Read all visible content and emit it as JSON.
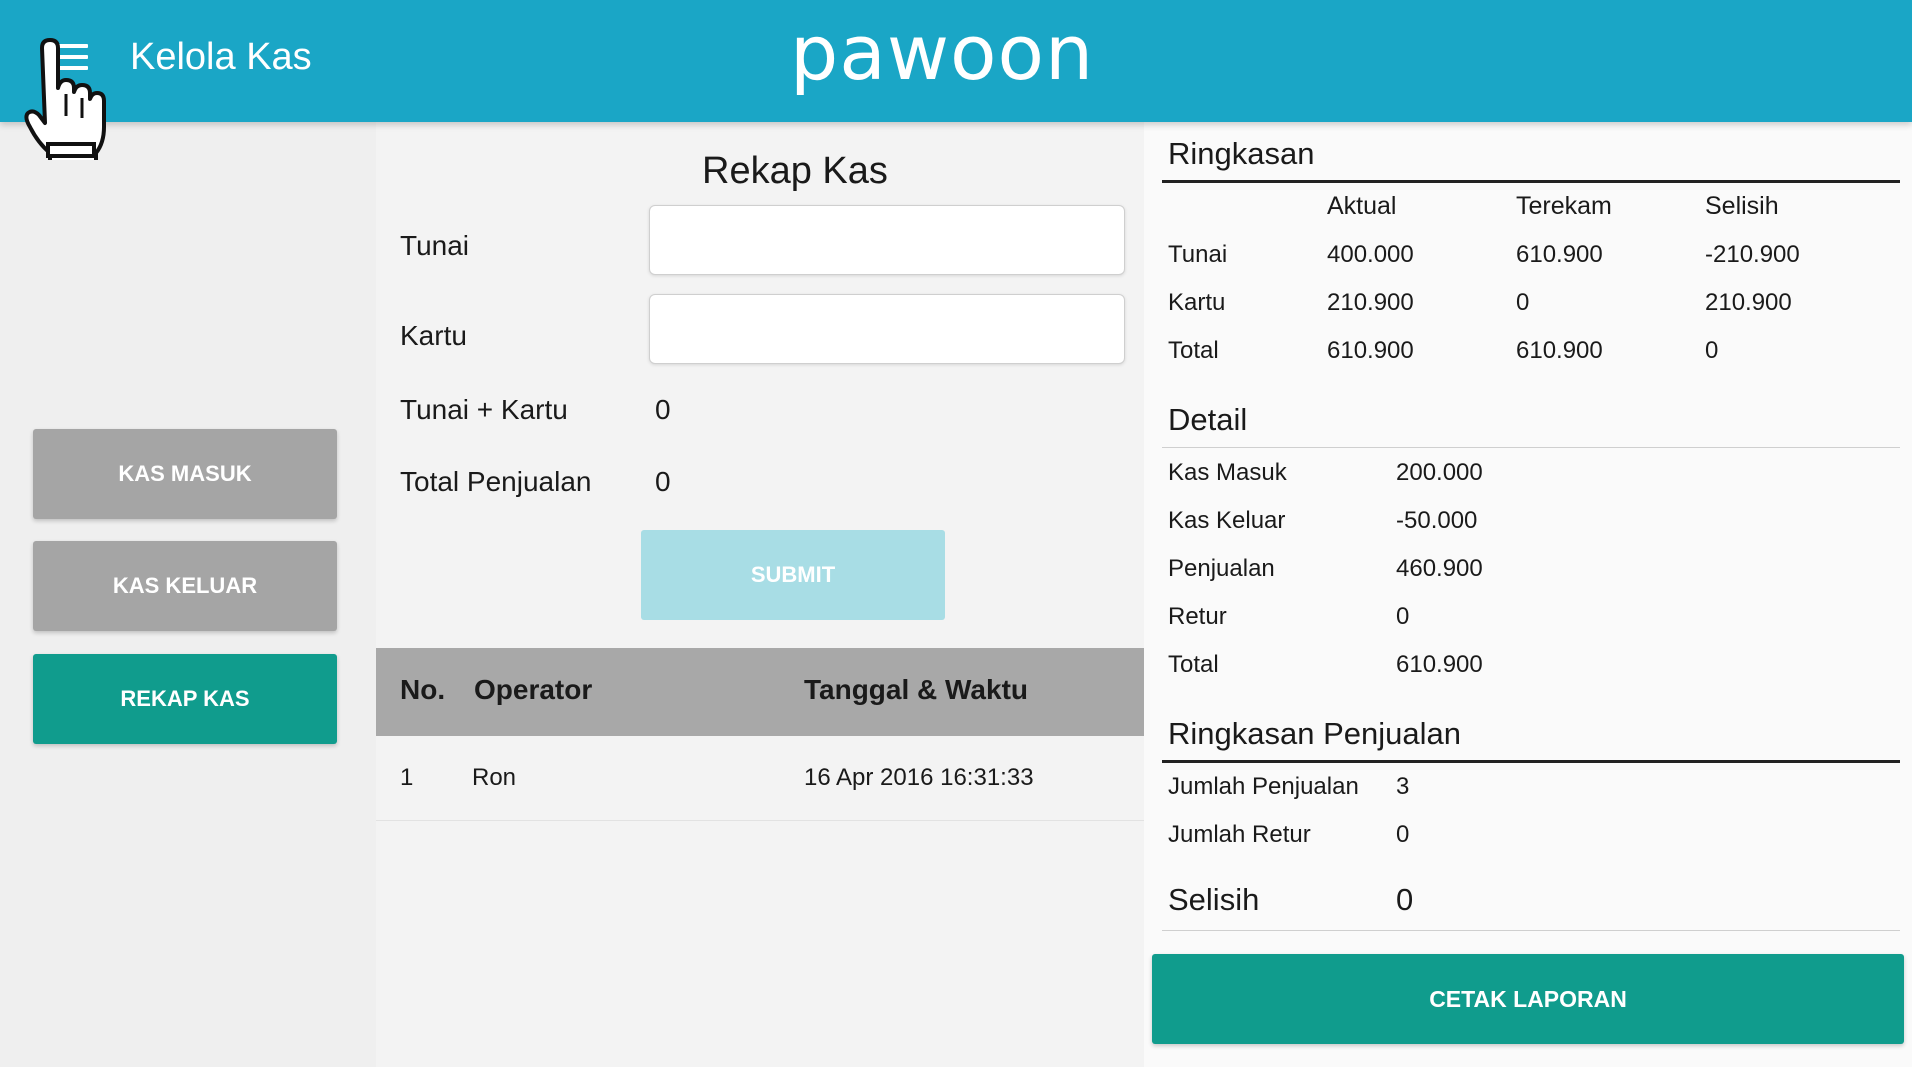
{
  "header": {
    "title": "Kelola Kas",
    "logo": "pawoon",
    "menu_icon": "hamburger-menu-icon",
    "cursor_icon": "hand-pointer-icon",
    "color": "#1aa6c6"
  },
  "sidebar": {
    "kas_masuk": "KAS MASUK",
    "kas_keluar": "KAS KELUAR",
    "rekap_kas": "REKAP KAS"
  },
  "form": {
    "title": "Rekap Kas",
    "tunai_label": "Tunai",
    "tunai_value": "",
    "kartu_label": "Kartu",
    "kartu_value": "",
    "tunai_kartu_label": "Tunai + Kartu",
    "tunai_kartu_value": "0",
    "total_penjualan_label": "Total Penjualan",
    "total_penjualan_value": "0",
    "submit_label": "SUBMIT"
  },
  "history": {
    "columns": [
      "No.",
      "Operator",
      "Tanggal & Waktu"
    ],
    "rows": [
      {
        "no": "1",
        "operator": "Ron",
        "datetime": "16 Apr 2016 16:31:33"
      }
    ]
  },
  "ringkasan": {
    "title": "Ringkasan",
    "columns": [
      "Aktual",
      "Terekam",
      "Selisih"
    ],
    "rows": [
      {
        "label": "Tunai",
        "aktual": "400.000",
        "terekam": "610.900",
        "selisih": "-210.900"
      },
      {
        "label": "Kartu",
        "aktual": "210.900",
        "terekam": "0",
        "selisih": "210.900"
      },
      {
        "label": "Total",
        "aktual": "610.900",
        "terekam": "610.900",
        "selisih": "0"
      }
    ]
  },
  "detail": {
    "title": "Detail",
    "rows": [
      {
        "label": "Kas Masuk",
        "value": "200.000"
      },
      {
        "label": "Kas Keluar",
        "value": "-50.000"
      },
      {
        "label": "Penjualan",
        "value": "460.900"
      },
      {
        "label": "Retur",
        "value": "0"
      },
      {
        "label": "Total",
        "value": "610.900"
      }
    ]
  },
  "ringkasan_penjualan": {
    "title": "Ringkasan Penjualan",
    "rows": [
      {
        "label": "Jumlah Penjualan",
        "value": "3"
      },
      {
        "label": "Jumlah Retur",
        "value": "0"
      }
    ],
    "selisih_label": "Selisih",
    "selisih_value": "0"
  },
  "actions": {
    "print_label": "CETAK LAPORAN"
  }
}
